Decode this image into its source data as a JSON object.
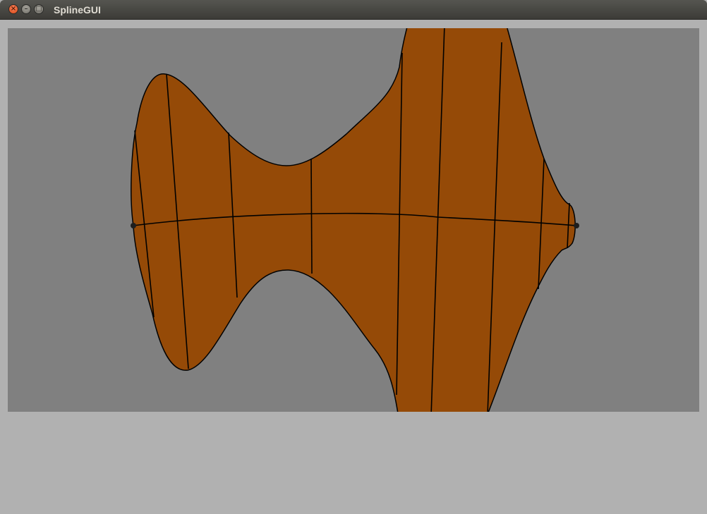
{
  "window": {
    "title": "SplineGUI"
  },
  "titlebar_buttons": {
    "close_glyph": "×",
    "minimize_glyph": "–",
    "maximize_glyph": "□"
  },
  "canvas": {
    "background_color": "#808080",
    "shape_fill_color": "#954a07",
    "stroke_color": "#000000"
  }
}
